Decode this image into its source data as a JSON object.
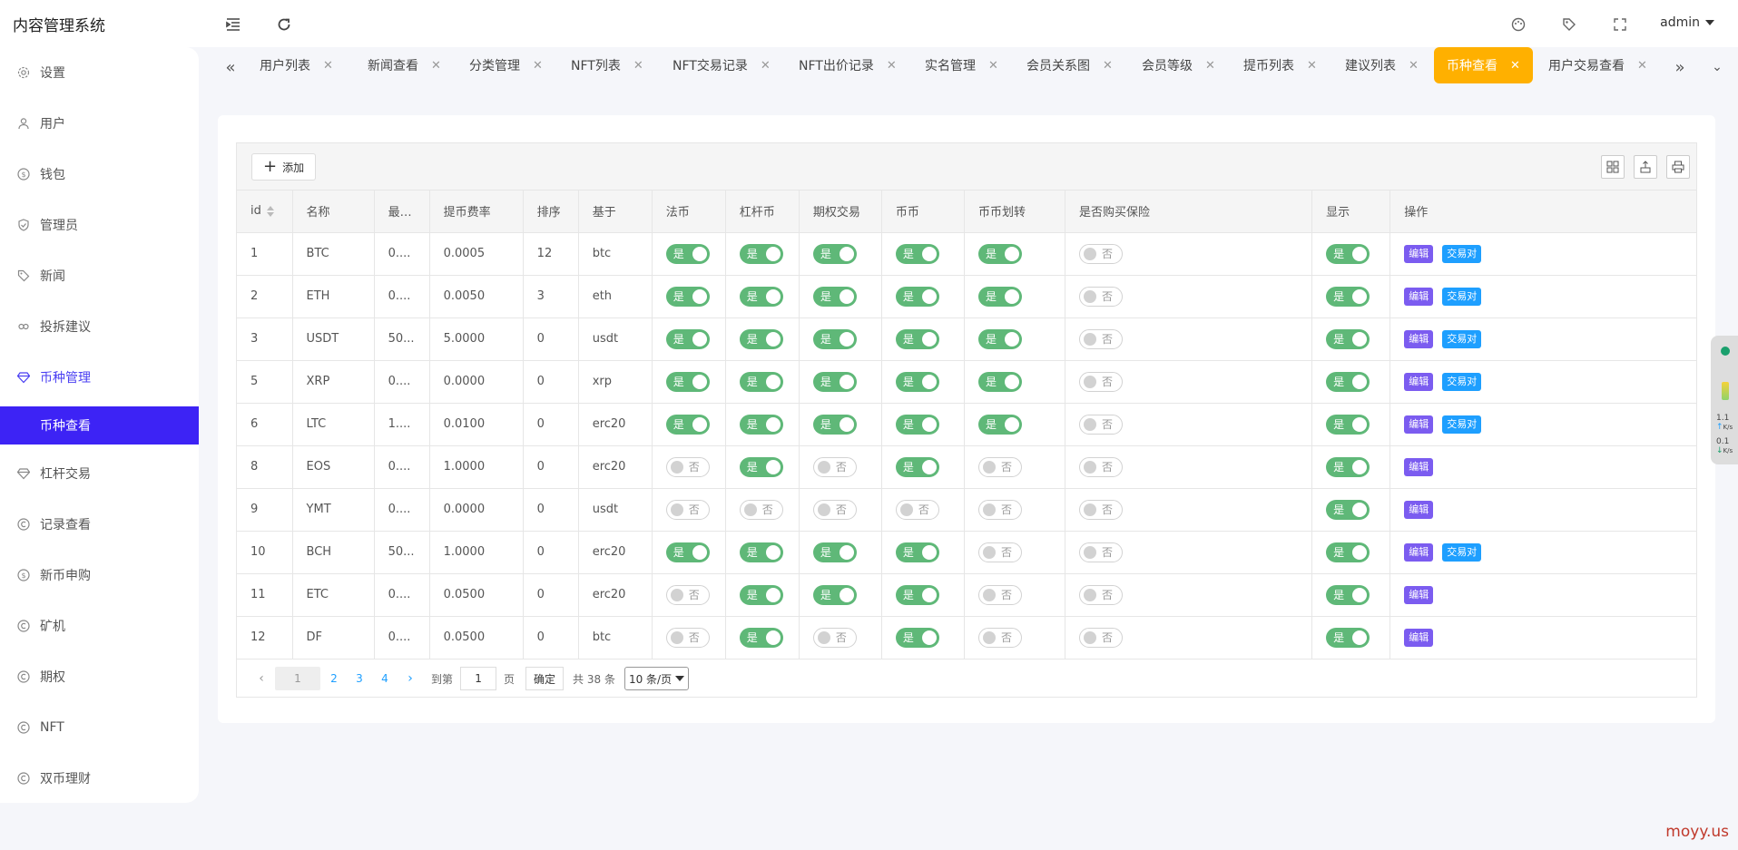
{
  "app": {
    "title": "内容管理系统"
  },
  "header": {
    "user": "admin"
  },
  "sidebar": {
    "items": [
      {
        "label": "设置"
      },
      {
        "label": "用户"
      },
      {
        "label": "钱包"
      },
      {
        "label": "管理员"
      },
      {
        "label": "新闻"
      },
      {
        "label": "投拆建议"
      },
      {
        "label": "币种管理"
      },
      {
        "label": "杠杆交易"
      },
      {
        "label": "记录查看"
      },
      {
        "label": "新币申购"
      },
      {
        "label": "矿机"
      },
      {
        "label": "期权"
      },
      {
        "label": "NFT"
      },
      {
        "label": "双币理财"
      }
    ],
    "sub_active": "币种查看"
  },
  "tabs": [
    {
      "label": "用户列表"
    },
    {
      "label": "新闻查看"
    },
    {
      "label": "分类管理"
    },
    {
      "label": "NFT列表"
    },
    {
      "label": "NFT交易记录"
    },
    {
      "label": "NFT出价记录"
    },
    {
      "label": "实名管理"
    },
    {
      "label": "会员关系图"
    },
    {
      "label": "会员等级"
    },
    {
      "label": "提币列表"
    },
    {
      "label": "建议列表"
    },
    {
      "label": "币种查看"
    },
    {
      "label": "用户交易查看"
    }
  ],
  "toolbar": {
    "add_label": "添加"
  },
  "table": {
    "headers": [
      "id",
      "名称",
      "最…",
      "提币费率",
      "排序",
      "基于",
      "法币",
      "杠杆币",
      "期权交易",
      "币币",
      "币币划转",
      "是否购买保险",
      "显示",
      "操作"
    ],
    "switch_on": "是",
    "switch_off": "否",
    "edit_label": "编辑",
    "pair_label": "交易对",
    "rows": [
      {
        "id": "1",
        "name": "BTC",
        "min": "0....",
        "fee": "0.0005",
        "sort": "12",
        "base": "btc",
        "fiat": true,
        "lever": true,
        "option": true,
        "coin": true,
        "transfer": true,
        "insure": false,
        "show": true,
        "pair": true
      },
      {
        "id": "2",
        "name": "ETH",
        "min": "0....",
        "fee": "0.0050",
        "sort": "3",
        "base": "eth",
        "fiat": true,
        "lever": true,
        "option": true,
        "coin": true,
        "transfer": true,
        "insure": false,
        "show": true,
        "pair": true
      },
      {
        "id": "3",
        "name": "USDT",
        "min": "50...",
        "fee": "5.0000",
        "sort": "0",
        "base": "usdt",
        "fiat": true,
        "lever": true,
        "option": true,
        "coin": true,
        "transfer": true,
        "insure": false,
        "show": true,
        "pair": true
      },
      {
        "id": "5",
        "name": "XRP",
        "min": "0....",
        "fee": "0.0000",
        "sort": "0",
        "base": "xrp",
        "fiat": true,
        "lever": true,
        "option": true,
        "coin": true,
        "transfer": true,
        "insure": false,
        "show": true,
        "pair": true
      },
      {
        "id": "6",
        "name": "LTC",
        "min": "1....",
        "fee": "0.0100",
        "sort": "0",
        "base": "erc20",
        "fiat": true,
        "lever": true,
        "option": true,
        "coin": true,
        "transfer": true,
        "insure": false,
        "show": true,
        "pair": true
      },
      {
        "id": "8",
        "name": "EOS",
        "min": "0....",
        "fee": "1.0000",
        "sort": "0",
        "base": "erc20",
        "fiat": false,
        "lever": true,
        "option": false,
        "coin": true,
        "transfer": false,
        "insure": false,
        "show": true,
        "pair": false
      },
      {
        "id": "9",
        "name": "YMT",
        "min": "0....",
        "fee": "0.0000",
        "sort": "0",
        "base": "usdt",
        "fiat": false,
        "lever": false,
        "option": false,
        "coin": false,
        "transfer": false,
        "insure": false,
        "show": true,
        "pair": false
      },
      {
        "id": "10",
        "name": "BCH",
        "min": "50...",
        "fee": "1.0000",
        "sort": "0",
        "base": "erc20",
        "fiat": true,
        "lever": true,
        "option": true,
        "coin": true,
        "transfer": false,
        "insure": false,
        "show": true,
        "pair": true
      },
      {
        "id": "11",
        "name": "ETC",
        "min": "0....",
        "fee": "0.0500",
        "sort": "0",
        "base": "erc20",
        "fiat": false,
        "lever": true,
        "option": true,
        "coin": true,
        "transfer": false,
        "insure": false,
        "show": true,
        "pair": false
      },
      {
        "id": "12",
        "name": "DF",
        "min": "0....",
        "fee": "0.0500",
        "sort": "0",
        "base": "btc",
        "fiat": false,
        "lever": true,
        "option": false,
        "coin": true,
        "transfer": false,
        "insure": false,
        "show": true,
        "pair": false
      }
    ]
  },
  "pagination": {
    "pages": [
      "1",
      "2",
      "3",
      "4"
    ],
    "goto_label": "到第",
    "page_input": "1",
    "page_unit": "页",
    "confirm_label": "确定",
    "total_label": "共 38 条",
    "page_size": "10 条/页"
  },
  "widget": {
    "up_speed": "1.1",
    "down_speed": "0.1",
    "unit": "K/s"
  },
  "watermark": "moyy.us",
  "colors": {
    "accent": "#3d23f5",
    "tab_active": "#ffb000",
    "switch_on": "#5fb878",
    "edit": "#7b5cf0",
    "pair": "#1e9fff"
  }
}
